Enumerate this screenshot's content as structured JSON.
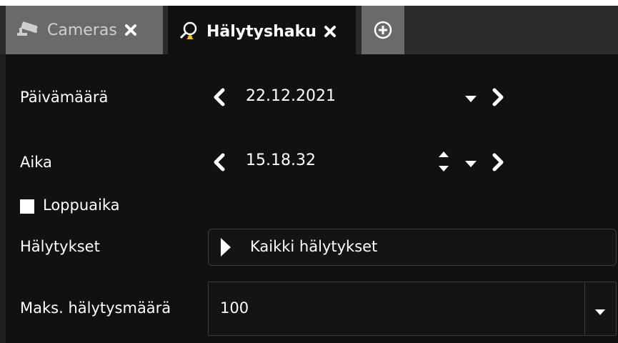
{
  "tabs": [
    {
      "label": "Cameras",
      "icon": "cctv-camera-icon",
      "active": false
    },
    {
      "label": "Hälytyshaku",
      "icon": "alarm-search-icon",
      "active": true
    }
  ],
  "add_tab_icon": "plus-circle-icon",
  "form": {
    "date": {
      "label": "Päivämäärä",
      "value": "22.12.2021"
    },
    "time": {
      "label": "Aika",
      "value": "15.18.32"
    },
    "end_time": {
      "label": "Loppuaika",
      "checked": false
    },
    "alarms": {
      "label": "Hälytykset",
      "value": "Kaikki hälytykset"
    },
    "max_alarms": {
      "label": "Maks. hälytysmäärä",
      "value": "100"
    }
  },
  "colors": {
    "background": "#111111",
    "tab_inactive": "#6a6a6a",
    "accent_bell": "#f0c419"
  }
}
